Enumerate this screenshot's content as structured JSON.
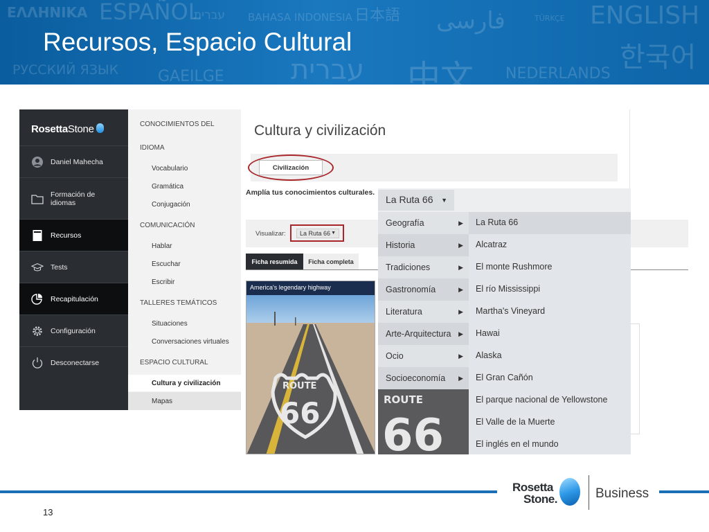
{
  "banner": {
    "title": "Recursos, Espacio Cultural",
    "watermarks": [
      "ΕΛΛΗΝΙΚΑ",
      "ESPAÑOL",
      "עברית",
      "BAHASA INDONESIA",
      "日本語",
      "فارسی",
      "TÜRKÇE",
      "ENGLISH",
      "한국어",
      "РУССКИЙ ЯЗЫК",
      "GAEILGE",
      "עברית",
      "中文",
      "NEDERLANDS"
    ]
  },
  "app": {
    "logo_bold": "Rosetta",
    "logo_light": "Stone",
    "sidebar": [
      {
        "label": "Daniel Mahecha",
        "icon": "user-icon"
      },
      {
        "label": "Formación de idiomas",
        "icon": "folder-icon"
      },
      {
        "label": "Recursos",
        "icon": "book-icon",
        "active": true
      },
      {
        "label": "Tests",
        "icon": "graduation-cap-icon"
      },
      {
        "label": "Recapitulación",
        "icon": "pie-chart-icon"
      },
      {
        "label": "Configuración",
        "icon": "gear-icon"
      },
      {
        "label": "Desconectarse",
        "icon": "power-icon"
      }
    ],
    "subnav": {
      "sec1a": "CONOCIMIENTOS DEL",
      "sec1b": "IDIOMA",
      "vocabulario": "Vocabulario",
      "gramatica": "Gramática",
      "conjugacion": "Conjugación",
      "sec2": "COMUNICACIÓN",
      "hablar": "Hablar",
      "escuchar": "Escuchar",
      "escribir": "Escribir",
      "sec3": "TALLERES TEMÁTICOS",
      "situaciones": "Situaciones",
      "conversaciones": "Conversaciones virtuales",
      "sec4": "ESPACIO CULTURAL",
      "cultura": "Cultura y civilización",
      "mapas": "Mapas"
    },
    "main": {
      "title": "Cultura y civilización",
      "civ_button": "Civilización",
      "subtitle": "Amplía tus conocimientos culturales.",
      "visualizar_label": "Visualizar:",
      "visualizar_value": "La Ruta 66",
      "tab_resumida": "Ficha resumida",
      "tab_completa": "Ficha completa",
      "photo_caption": "America's legendary highway"
    },
    "dropdown": {
      "selected": "La Ruta 66",
      "categories": [
        "Geografía",
        "Historia",
        "Tradiciones",
        "Gastronomía",
        "Literatura",
        "Arte-Arquitectura",
        "Ocio",
        "Socioeconomía"
      ],
      "items": [
        "La Ruta 66",
        "Alcatraz",
        "El monte Rushmore",
        "El río Mississippi",
        "Martha's Vineyard",
        "Hawai",
        "Alaska",
        "El Gran Cañón",
        "El parque nacional de Yellowstone",
        "El Valle de la Muerte",
        "El inglés en el mundo"
      ]
    }
  },
  "footer": {
    "logo_line1": "Rosetta",
    "logo_line2": "Stone.",
    "business": "Business",
    "page": "13"
  },
  "colors": {
    "banner_blue": "#1a78bf",
    "sidebar_dark": "#2a2e33",
    "highlight_red": "#a8262a"
  }
}
